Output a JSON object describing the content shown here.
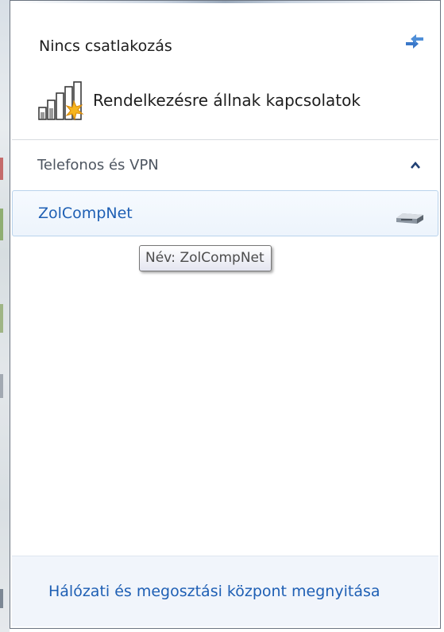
{
  "status": {
    "title": "Nincs csatlakozás",
    "refresh_icon": "refresh-icon",
    "available_icon": "signal-bars-star-icon",
    "available_label": "Rendelkezésre állnak kapcsolatok"
  },
  "section": {
    "label": "Telefonos és VPN",
    "collapse_icon": "chevron-up-icon",
    "expanded": true
  },
  "connections": [
    {
      "name": "ZolCompNet",
      "icon": "modem-icon"
    }
  ],
  "tooltip": {
    "text": "Név: ZolCompNet"
  },
  "footer": {
    "link": "Hálózati és megosztási központ megnyitása"
  },
  "colors": {
    "link": "#1e5fb4",
    "text": "#1e1e1e",
    "section_text": "#4d5560",
    "hover_bg": "#edf4fc",
    "footer_bg": "#f1f5fb"
  }
}
